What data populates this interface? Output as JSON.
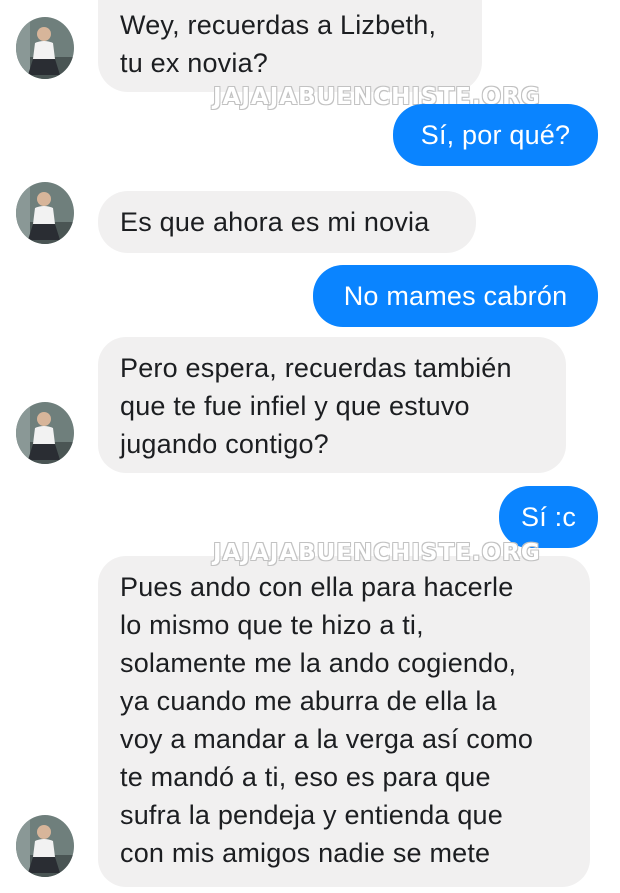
{
  "watermark": "JAJAJABUENCHISTE.ORG",
  "contact": {
    "avatar_icon": "contact-avatar-icon"
  },
  "colors": {
    "incoming_bubble": "#f1f0f0",
    "outgoing_bubble": "#0a84ff",
    "incoming_text": "#1c1e21",
    "outgoing_text": "#ffffff"
  },
  "messages": [
    {
      "from": "contact",
      "lines": [
        "Wey, recuerdas a Lizbeth,",
        "tu ex novia?"
      ]
    },
    {
      "from": "me",
      "lines": [
        "Sí, por qué?"
      ]
    },
    {
      "from": "contact",
      "lines": [
        "Es que ahora es mi novia"
      ]
    },
    {
      "from": "me",
      "lines": [
        "No mames cabrón"
      ]
    },
    {
      "from": "contact",
      "lines": [
        "Pero espera, recuerdas también",
        "que te fue infiel y que estuvo",
        "jugando contigo?"
      ]
    },
    {
      "from": "me",
      "lines": [
        "Sí :c"
      ]
    },
    {
      "from": "contact",
      "lines": [
        "Pues ando con ella para hacerle",
        "lo mismo que te hizo a ti,",
        "solamente me la ando cogiendo,",
        "ya cuando me aburra de ella la",
        "voy a mandar a la verga así como",
        "te mandó a ti, eso es para que",
        "sufra la pendeja y entienda que",
        "con mis amigos nadie se mete"
      ]
    }
  ]
}
